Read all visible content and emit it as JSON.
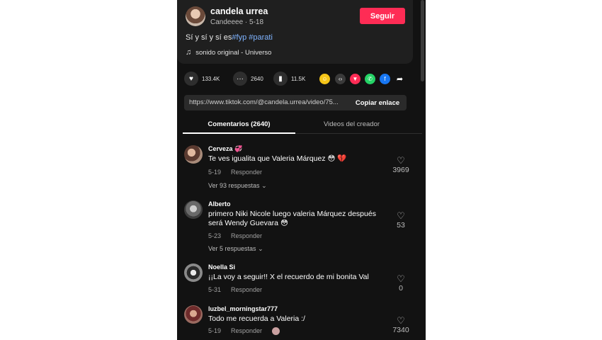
{
  "author": {
    "name": "candela urrea",
    "meta": "Candeeee · 5-18",
    "follow_label": "Seguir"
  },
  "caption": {
    "text": "Sí y sí y sí es",
    "tags": [
      "#fyp",
      "#parati"
    ]
  },
  "music": {
    "label": "sonido original - Universo",
    "icon": "music-note-icon"
  },
  "actions": {
    "likes": "133.4K",
    "comments": "2640",
    "saves": "11.5K",
    "share_icons": [
      "friends-icon",
      "embed-icon",
      "send-icon",
      "whatsapp-icon",
      "facebook-icon",
      "share-arrow-icon"
    ]
  },
  "link": {
    "url": "https://www.tiktok.com/@candela.urrea/video/75...",
    "copy_label": "Copiar enlace"
  },
  "tabs": {
    "comments": "Comentarios (2640)",
    "creator": "Videos del creador"
  },
  "comments": [
    {
      "user": "Cerveza",
      "user_emoji": "💞",
      "text": "Te ves igualita que Valeria Márquez 😳 💔",
      "date": "5-19",
      "reply": "Responder",
      "likes": "3969",
      "more": "Ver 93 respuestas"
    },
    {
      "user": "Alberto",
      "text": "primero Niki Nicole luego valeria Márquez después será Wendy Guevara 😳",
      "date": "5-23",
      "reply": "Responder",
      "likes": "53",
      "more": "Ver 5 respuestas"
    },
    {
      "user": "Noella Si",
      "text": "¡¡La voy a seguir!! X el recuerdo de mi bonita Val",
      "date": "5-31",
      "reply": "Responder",
      "likes": "0"
    },
    {
      "user": "luzbel_morningstar777",
      "text": "Todo me recuerda a Valeria :/",
      "date": "5-19",
      "reply": "Responder",
      "likes": "7340"
    }
  ],
  "colors": {
    "accent": "#fe2c55",
    "hashtag": "#7fb3ff",
    "panel": "#121212"
  }
}
